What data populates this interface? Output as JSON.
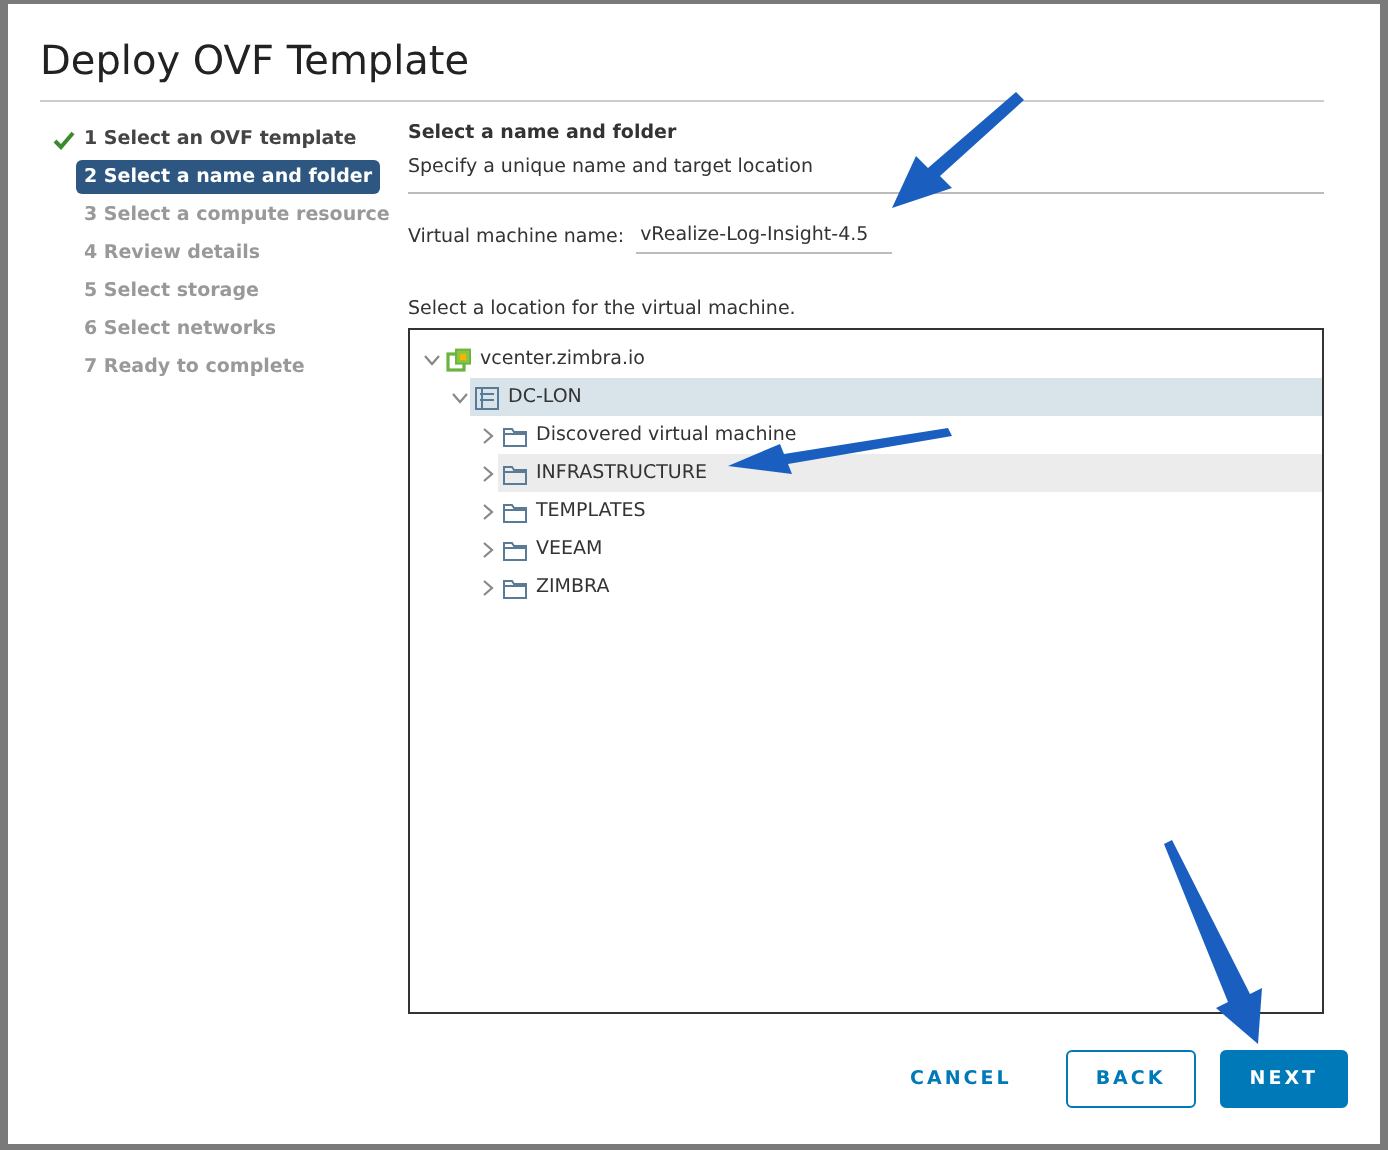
{
  "dialog": {
    "title": "Deploy OVF Template"
  },
  "steps": [
    {
      "label": "1 Select an OVF template",
      "completed": true,
      "selected": false,
      "disabled": false
    },
    {
      "label": "2 Select a name and folder",
      "completed": false,
      "selected": true,
      "disabled": false
    },
    {
      "label": "3 Select a compute resource",
      "completed": false,
      "selected": false,
      "disabled": true
    },
    {
      "label": "4 Review details",
      "completed": false,
      "selected": false,
      "disabled": true
    },
    {
      "label": "5 Select storage",
      "completed": false,
      "selected": false,
      "disabled": true
    },
    {
      "label": "6 Select networks",
      "completed": false,
      "selected": false,
      "disabled": true
    },
    {
      "label": "7 Ready to complete",
      "completed": false,
      "selected": false,
      "disabled": true
    }
  ],
  "page": {
    "heading": "Select a name and folder",
    "subtitle": "Specify a unique name and target location",
    "vm_name_label": "Virtual machine name:",
    "vm_name_value": "vRealize-Log-Insight-4.5",
    "location_label": "Select a location for the virtual machine."
  },
  "tree": [
    {
      "label": "vcenter.zimbra.io",
      "kind": "vcenter",
      "expanded": true,
      "selected": false,
      "hovered": false,
      "children": [
        {
          "label": "DC-LON",
          "kind": "datacenter",
          "expanded": true,
          "selected": true,
          "hovered": false,
          "children": [
            {
              "label": "Discovered virtual machine",
              "kind": "folder",
              "expanded": false,
              "selected": false,
              "hovered": false
            },
            {
              "label": "INFRASTRUCTURE",
              "kind": "folder",
              "expanded": false,
              "selected": false,
              "hovered": true
            },
            {
              "label": "TEMPLATES",
              "kind": "folder",
              "expanded": false,
              "selected": false,
              "hovered": false
            },
            {
              "label": "VEEAM",
              "kind": "folder",
              "expanded": false,
              "selected": false,
              "hovered": false
            },
            {
              "label": "ZIMBRA",
              "kind": "folder",
              "expanded": false,
              "selected": false,
              "hovered": false
            }
          ]
        }
      ]
    }
  ],
  "buttons": [
    {
      "label": "CANCEL",
      "kind": "flat"
    },
    {
      "label": "BACK",
      "kind": "outline"
    },
    {
      "label": "NEXT",
      "kind": "primary"
    }
  ]
}
